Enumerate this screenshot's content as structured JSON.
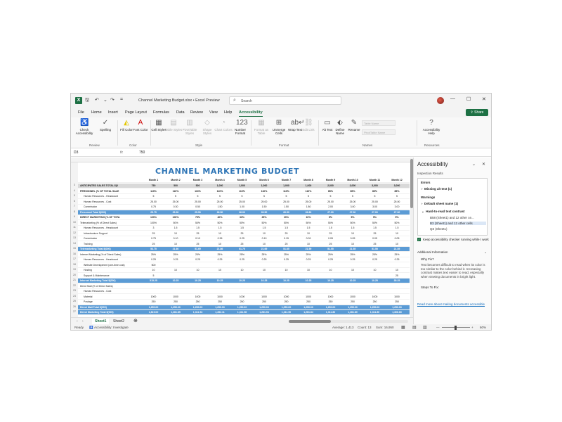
{
  "window": {
    "title": "Channel Marketing Budget.xlsx  •  Excel Preview",
    "search_placeholder": "Search"
  },
  "menu": [
    "File",
    "Home",
    "Insert",
    "Page Layout",
    "Formulas",
    "Data",
    "Review",
    "View",
    "Help",
    "Accessibility"
  ],
  "share_label": "Share",
  "ribbon": {
    "check_accessibility": "Check Accessibility",
    "spelling": "Spelling",
    "fill_color": "Fill Color",
    "font_color": "Font Color",
    "cell_styles": "Cell Styles",
    "table_styles": "Table Styles",
    "pivottable_styles": "PivotTable Styles",
    "shape_styles": "Shape Styles",
    "chart_colors": "Chart Colors",
    "number_format": "Number Format",
    "format_as_table": "Format as Table",
    "unmerge_cells": "Unmerge Cells",
    "wrap_text": "Wrap Text",
    "edit_link": "Edit Link",
    "alt_text": "Alt Text",
    "define_name": "Define Name",
    "rename": "Rename",
    "table_name": "Table Name",
    "pivottable_name": "PivotTable Name",
    "accessibility_help": "Accessibility Help",
    "groups": [
      "Review",
      "Color",
      "Style",
      "Format",
      "Names",
      "Resources"
    ]
  },
  "formula_bar": {
    "cell": "D3",
    "fx": "fx",
    "value": "750"
  },
  "sheet": {
    "title": "CHANNEL MARKETING BUDGET",
    "months": [
      "Month 1",
      "Month 2",
      "Month 3",
      "Month 4",
      "Month 5",
      "Month 6",
      "Month 7",
      "Month 8",
      "Month 9",
      "Month 10",
      "Month 11",
      "Month 12"
    ],
    "rows": [
      {
        "n": "3",
        "label": "ANTICIPATED SALES TOTAL $(0",
        "style": "grey bold",
        "v": [
          "750",
          "500",
          "500",
          "1,000",
          "1,000",
          "1,000",
          "1,000",
          "1,000",
          "2,000",
          "3,000",
          "3,000",
          "3,000"
        ]
      },
      {
        "n": "4",
        "label": "PERSONNEL (% OF TOTAL SALE",
        "style": "bold",
        "v": [
          "110%",
          "110%",
          "110%",
          "110%",
          "110%",
          "110%",
          "110%",
          "110%",
          "85%",
          "85%",
          "85%",
          "85%"
        ]
      },
      {
        "n": "5",
        "label": "Human Resources - Headcount",
        "style": "ind",
        "v": [
          "5",
          "5",
          "5",
          "5",
          "5",
          "5",
          "5",
          "5",
          "5",
          "5",
          "5",
          "5"
        ]
      },
      {
        "n": "6",
        "label": "Human Resources - Cost",
        "style": "ind",
        "v": [
          "25.00",
          "25.00",
          "25.00",
          "25.00",
          "25.00",
          "25.00",
          "25.00",
          "25.00",
          "25.00",
          "25.00",
          "25.00",
          "25.00"
        ]
      },
      {
        "n": "7",
        "label": "Commission",
        "style": "ind",
        "v": [
          "0.75",
          "0.30",
          "0.50",
          "1.50",
          "1.00",
          "1.50",
          "1.50",
          "1.80",
          "2.00",
          "3.00",
          "3.00",
          "3.00"
        ]
      },
      {
        "n": "8",
        "label": "Personnel Total $(000)",
        "style": "teal",
        "v": [
          "25.75",
          "25.30",
          "25.50",
          "26.50",
          "26.00",
          "26.50",
          "26.50",
          "26.80",
          "27.00",
          "27.00",
          "27.00",
          "27.00"
        ]
      },
      {
        "n": "9",
        "label": "DIRECT MARKETING (% OF TOTA",
        "style": "bold",
        "v": [
          "100%",
          "100%",
          "75%",
          "40%",
          "33%",
          "25%",
          "20%",
          "10%",
          "5%",
          "5%",
          "5%",
          "5%"
        ]
      },
      {
        "n": "10",
        "label": "Telemarketing (% of Direct Sales)",
        "style": "",
        "v": [
          "100%",
          "50%",
          "50%",
          "50%",
          "50%",
          "50%",
          "50%",
          "50%",
          "50%",
          "50%",
          "50%",
          "50%"
        ]
      },
      {
        "n": "11",
        "label": "Human Resources - Headcount",
        "style": "ind",
        "v": [
          "3",
          "1.5",
          "1.5",
          "1.5",
          "1.5",
          "1.5",
          "1.5",
          "1.5",
          "1.5",
          "1.5",
          "1.5",
          "1.5"
        ]
      },
      {
        "n": "12",
        "label": "Infrastructure Support",
        "style": "ind",
        "v": [
          "25",
          "10",
          "25",
          "10",
          "25",
          "10",
          "25",
          "10",
          "25",
          "10",
          "25",
          "10"
        ]
      },
      {
        "n": "13",
        "label": "Commission",
        "style": "ind",
        "v": [
          "0.75",
          "0.10",
          "0.19",
          "0.36",
          "0.25",
          "0.19",
          "0.15",
          "0.09",
          "0.05",
          "0.05",
          "0.05",
          "0.05"
        ]
      },
      {
        "n": "14",
        "label": "Training",
        "style": "ind",
        "v": [
          "25",
          "10",
          "25",
          "10",
          "25",
          "10",
          "25",
          "10",
          "25",
          "10",
          "25",
          "10"
        ]
      },
      {
        "n": "15",
        "label": "Telemarketing Total $(000)",
        "style": "teal",
        "v": [
          "53.75",
          "21.60",
          "51.69",
          "21.86",
          "51.75",
          "21.69",
          "51.65",
          "21.59",
          "51.55",
          "21.55",
          "51.55",
          "21.55"
        ]
      },
      {
        "n": "16",
        "label": "Internet Marketing (% of Direct Sales)",
        "style": "",
        "v": [
          "25%",
          "25%",
          "25%",
          "25%",
          "25%",
          "25%",
          "25%",
          "25%",
          "25%",
          "25%",
          "25%",
          "25%"
        ]
      },
      {
        "n": "17",
        "label": "Human Resources - Headcount",
        "style": "ind",
        "v": [
          "0.25",
          "0.25",
          "0.25",
          "0.25",
          "0.25",
          "0.25",
          "0.25",
          "0.25",
          "0.25",
          "0.25",
          "0.25",
          "0.25"
        ]
      },
      {
        "n": "18",
        "label": "Website Development (one-time cost)",
        "style": "ind",
        "v": [
          "500",
          "",
          "",
          "",
          "",
          "",
          "",
          "",
          "",
          "",
          "",
          ""
        ]
      },
      {
        "n": "19",
        "label": "Hosting",
        "style": "ind",
        "v": [
          "10",
          "10",
          "10",
          "10",
          "10",
          "10",
          "10",
          "10",
          "10",
          "10",
          "10",
          "10"
        ]
      },
      {
        "n": "20",
        "label": "Support & Maintenance",
        "style": "ind",
        "v": [
          "5",
          "",
          "",
          "",
          "",
          "",
          "",
          "",
          "",
          "",
          "",
          "25"
        ]
      },
      {
        "n": "21",
        "label": "Internet Marketing Total $(000)",
        "style": "teal",
        "v": [
          "515.25",
          "10.25",
          "10.25",
          "10.25",
          "10.25",
          "10.25",
          "10.25",
          "10.25",
          "10.25",
          "10.25",
          "10.25",
          "35.25"
        ]
      },
      {
        "n": "22",
        "label": "Direct Mail (% of Direct Sales)",
        "style": "",
        "v": [
          "",
          "",
          "",
          "",
          "",
          "",
          "",
          "",
          "",
          "",
          "",
          ""
        ]
      },
      {
        "n": "23",
        "label": "Human Resources - Cost",
        "style": "ind",
        "v": [
          "",
          "",
          "",
          "",
          "",
          "",
          "",
          "",
          "",
          "",
          "",
          ""
        ]
      },
      {
        "n": "24",
        "label": "Material",
        "style": "ind",
        "v": [
          "1000",
          "1000",
          "1000",
          "1000",
          "1000",
          "1000",
          "1000",
          "1000",
          "1000",
          "1000",
          "1000",
          "1000"
        ]
      },
      {
        "n": "25",
        "label": "Postage",
        "style": "ind",
        "v": [
          "250",
          "250",
          "250",
          "250",
          "250",
          "250",
          "250",
          "250",
          "250",
          "250",
          "250",
          "250"
        ]
      },
      {
        "n": "26",
        "label": "Direct Mail Total $(000)",
        "style": "teal",
        "v": [
          "1,250.00",
          "1,250.00",
          "1,250.00",
          "1,250.00",
          "1,250.00",
          "1,250.00",
          "1,250.00",
          "1,250.00",
          "1,250.00",
          "1,250.00",
          "1,250.00",
          "1,250.00"
        ]
      },
      {
        "n": "27",
        "label": "Direct Marketing Total $(000)",
        "style": "teal",
        "v": [
          "1,819.00",
          "1,281.85",
          "1,311.94",
          "1,282.11",
          "1,311.98",
          "1,281.94",
          "1,311.90",
          "1,281.84",
          "1,311.80",
          "1,281.80",
          "1,311.80",
          "1,306.80"
        ]
      }
    ]
  },
  "tabs": [
    "Sheet1",
    "Sheet2"
  ],
  "status": {
    "ready": "Ready",
    "accessibility": "Accessibility: Investigate",
    "average": "Average: 1,413",
    "count": "Count: 13",
    "sum": "Sum: 16,950",
    "zoom": "60%"
  },
  "pane": {
    "title": "Accessibility",
    "subtitle": "Inspection Results",
    "errors": "Errors",
    "missing_alt": "Missing alt text (1)",
    "warnings": "Warnings",
    "default_sheet": "Default sheet name (1)",
    "hard_to_read": "Hard-to-read text contrast",
    "sub1": "B58 (Sheet1) and 12 other ce...",
    "sub2": "B3 (Sheet1) and 12 other cells",
    "sub3": "Q3 (Sheet1)",
    "keep": "Keep accessibility checker running while I work",
    "additional": "Additional Information",
    "why_fix": "Why Fix?",
    "why_text": "Text becomes difficult to read when its color is too similar to the color behind it. Increasing contrast makes text easier to read, especially when viewing documents in bright light.",
    "steps": "Steps To Fix:",
    "read_more": "Read more about making documents accessible"
  }
}
